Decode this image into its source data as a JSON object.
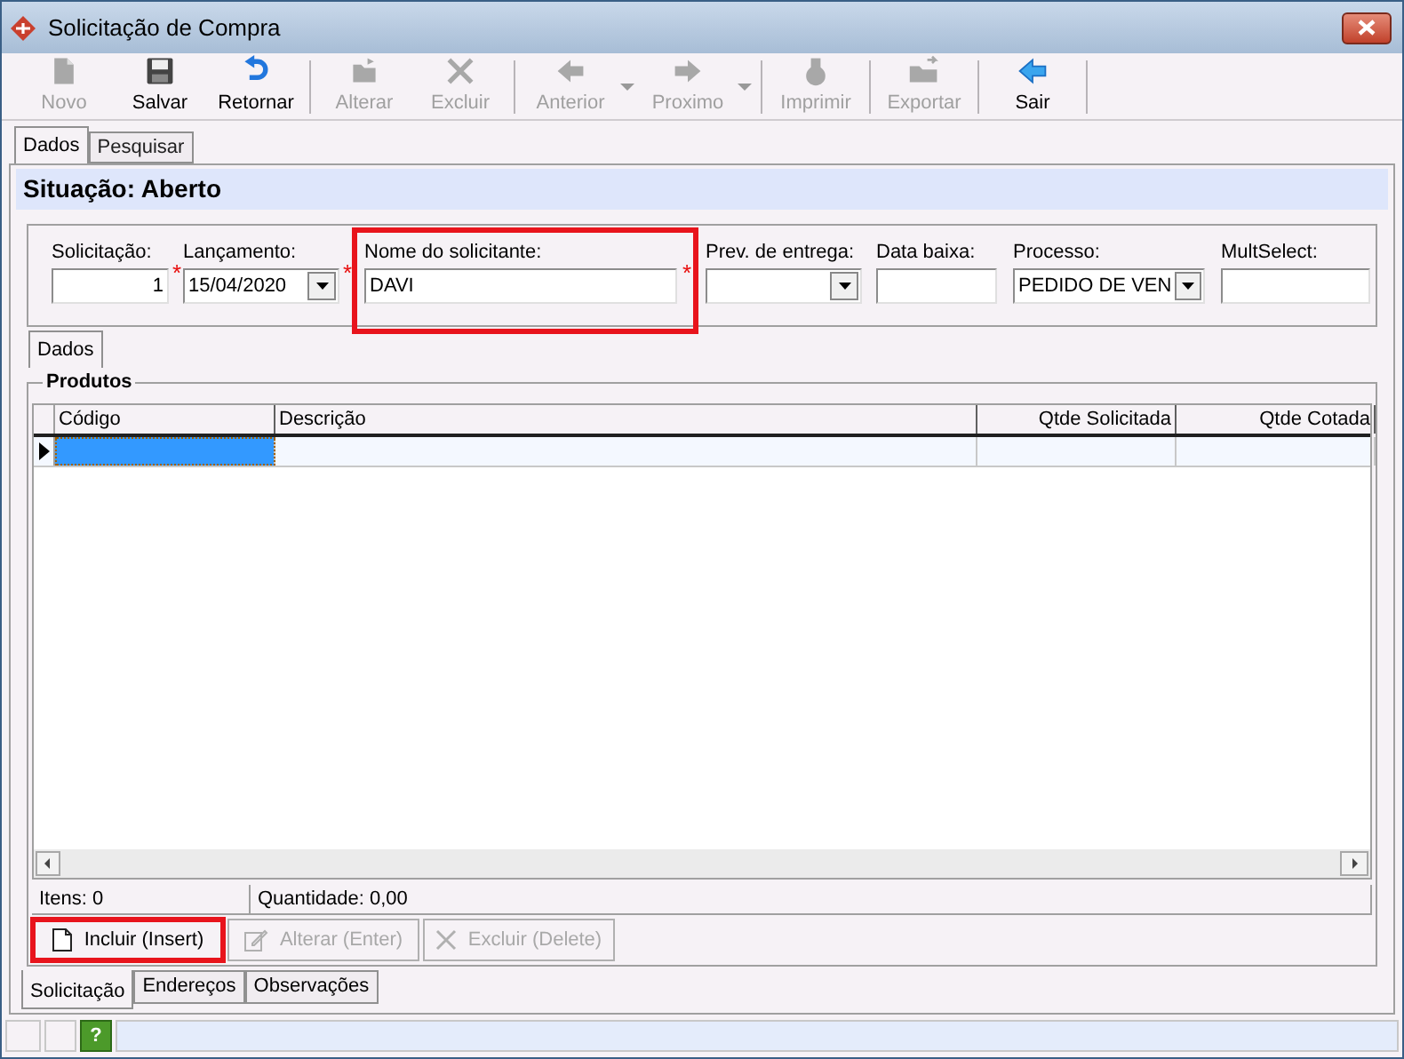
{
  "window": {
    "title": "Solicitação de Compra"
  },
  "toolbar": [
    {
      "kind": "button",
      "label": "Novo",
      "disabled": true,
      "dropdown": false
    },
    {
      "kind": "button",
      "label": "Salvar",
      "disabled": false,
      "dropdown": false
    },
    {
      "kind": "button",
      "label": "Retornar",
      "disabled": false,
      "dropdown": false
    },
    {
      "kind": "separator"
    },
    {
      "kind": "button",
      "label": "Alterar",
      "disabled": true,
      "dropdown": false
    },
    {
      "kind": "button",
      "label": "Excluir",
      "disabled": true,
      "dropdown": false
    },
    {
      "kind": "separator"
    },
    {
      "kind": "button",
      "label": "Anterior",
      "disabled": true,
      "dropdown": true
    },
    {
      "kind": "button",
      "label": "Proximo",
      "disabled": true,
      "dropdown": true
    },
    {
      "kind": "separator"
    },
    {
      "kind": "button",
      "label": "Imprimir",
      "disabled": true,
      "dropdown": false
    },
    {
      "kind": "separator"
    },
    {
      "kind": "button",
      "label": "Exportar",
      "disabled": true,
      "dropdown": false
    },
    {
      "kind": "separator"
    },
    {
      "kind": "button",
      "label": "Sair",
      "disabled": false,
      "dropdown": false
    },
    {
      "kind": "separator"
    }
  ],
  "tabs": [
    {
      "label": "Dados",
      "selected": true
    },
    {
      "label": "Pesquisar",
      "selected": false
    }
  ],
  "situation": "Situação: Aberto",
  "fields": [
    {
      "kind": "text",
      "label": "Solicitação:",
      "value": "1",
      "required_mark": "*",
      "highlighted": false
    },
    {
      "kind": "date",
      "label": "Lançamento:",
      "value": "15/04/2020",
      "required_mark": "*",
      "highlighted": false
    },
    {
      "kind": "text",
      "label": "Nome do solicitante:",
      "value": "DAVI",
      "required_mark": "*",
      "highlighted": true
    },
    {
      "kind": "date",
      "label": "Prev. de entrega:",
      "highlighted": false
    },
    {
      "kind": "text",
      "label": "Data baixa:",
      "highlighted": false
    },
    {
      "kind": "combo",
      "label": "Processo:",
      "value": "PEDIDO DE VEN",
      "highlighted": false
    },
    {
      "kind": "text",
      "label": "MultSelect:",
      "highlighted": false
    }
  ],
  "inner_tabs": [
    {
      "label": "Dados",
      "selected": true
    }
  ],
  "products": {
    "title": "Produtos",
    "table": {
      "columns": [
        "Código",
        "Descrição",
        "Qtde Solicitada",
        "Qtde Cotada"
      ],
      "rows": [
        {
          "current": true,
          "cells": [
            {
              "selected": true
            },
            {
              "selected": false
            },
            {
              "selected": false
            },
            {
              "selected": false
            }
          ]
        }
      ]
    },
    "footer": [
      "Itens: 0",
      "Quantidade: 0,00"
    ],
    "buttons": [
      {
        "label": "Incluir (Insert)",
        "disabled": false,
        "highlighted": true
      },
      {
        "label": "Alterar (Enter)",
        "disabled": true,
        "highlighted": false
      },
      {
        "label": "Excluir (Delete)",
        "disabled": true,
        "highlighted": false
      }
    ]
  },
  "bottom_tabs": [
    {
      "label": "Solicitação",
      "selected": true
    },
    {
      "label": "Endereços",
      "selected": false
    },
    {
      "label": "Observações",
      "selected": false
    }
  ],
  "status_bar": {
    "help_glyph": "?"
  }
}
